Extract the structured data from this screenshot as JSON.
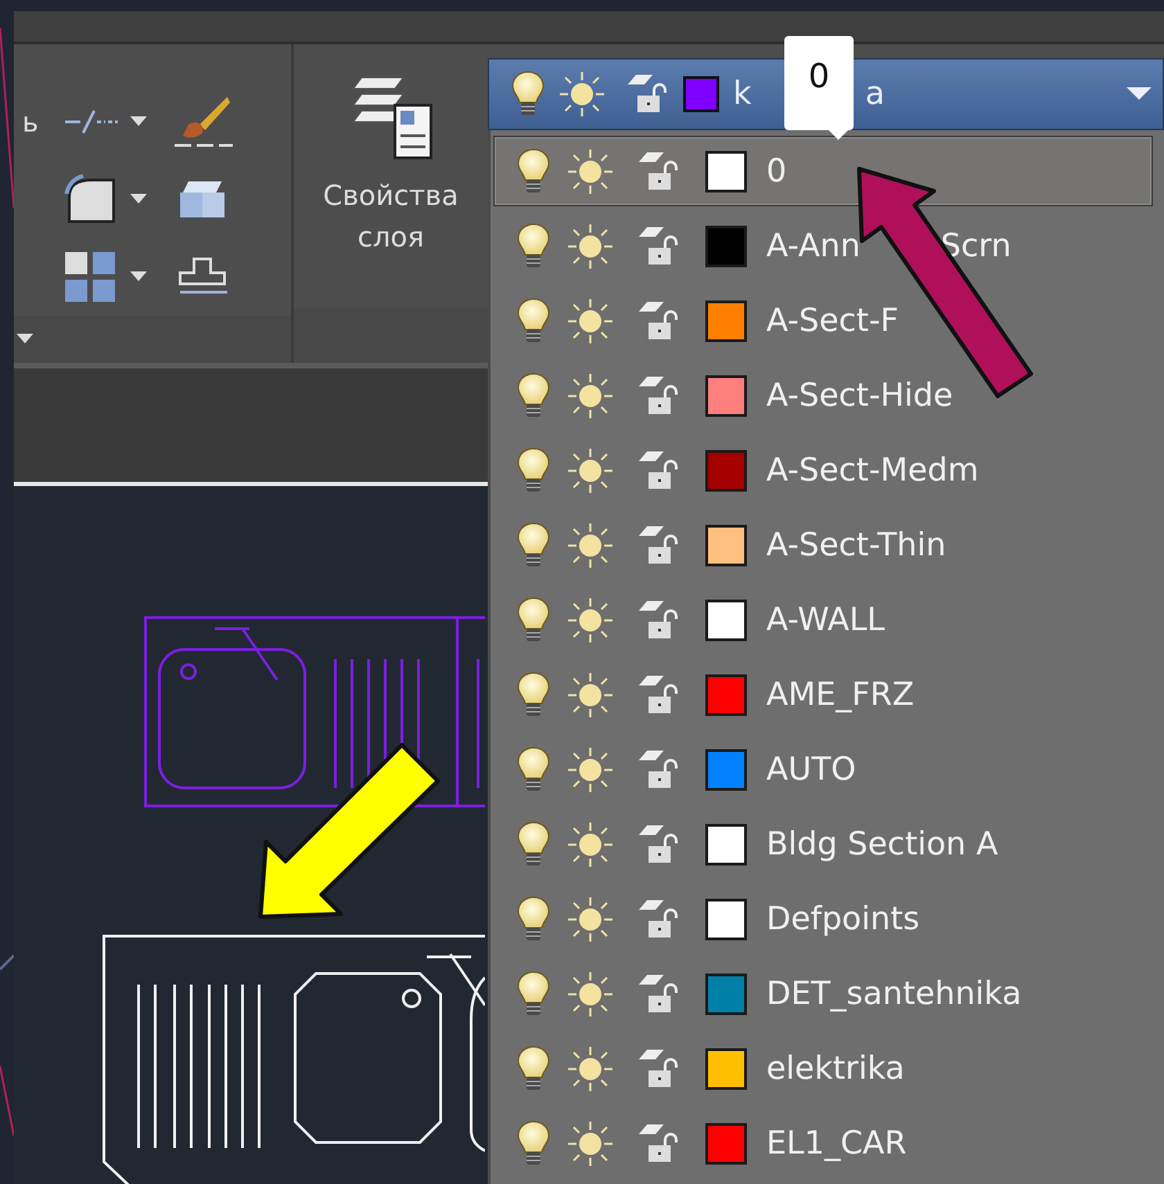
{
  "ribbon": {
    "cut_label": "ь",
    "layer_properties_label": "Свойства слоя"
  },
  "layer_combo": {
    "name_start": "k",
    "name_end": "a",
    "color": "#7f00ff"
  },
  "tooltip": {
    "text": "0"
  },
  "layers": [
    {
      "name": "0",
      "color": "#ffffff",
      "selected": true
    },
    {
      "name": "A-Ann",
      "name_tail": "Scrn",
      "color": "#000000",
      "selected": false
    },
    {
      "name": "A-Sect-F",
      "color": "#ff8000",
      "selected": false
    },
    {
      "name": "A-Sect-Hide",
      "color": "#ff7f7f",
      "selected": false
    },
    {
      "name": "A-Sect-Medm",
      "color": "#a50000",
      "selected": false
    },
    {
      "name": "A-Sect-Thin",
      "color": "#ffbf7f",
      "selected": false
    },
    {
      "name": "A-WALL",
      "color": "#ffffff",
      "selected": false
    },
    {
      "name": "AME_FRZ",
      "color": "#ff0000",
      "selected": false
    },
    {
      "name": "AUTO",
      "color": "#0080ff",
      "selected": false
    },
    {
      "name": "Bldg Section A",
      "color": "#ffffff",
      "selected": false
    },
    {
      "name": "Defpoints",
      "color": "#ffffff",
      "selected": false
    },
    {
      "name": "DET_santehnika",
      "color": "#0080a8",
      "selected": false
    },
    {
      "name": "elektrika",
      "color": "#ffbf00",
      "selected": false
    },
    {
      "name": "EL1_CAR",
      "color": "#ff0000",
      "selected": false
    }
  ]
}
